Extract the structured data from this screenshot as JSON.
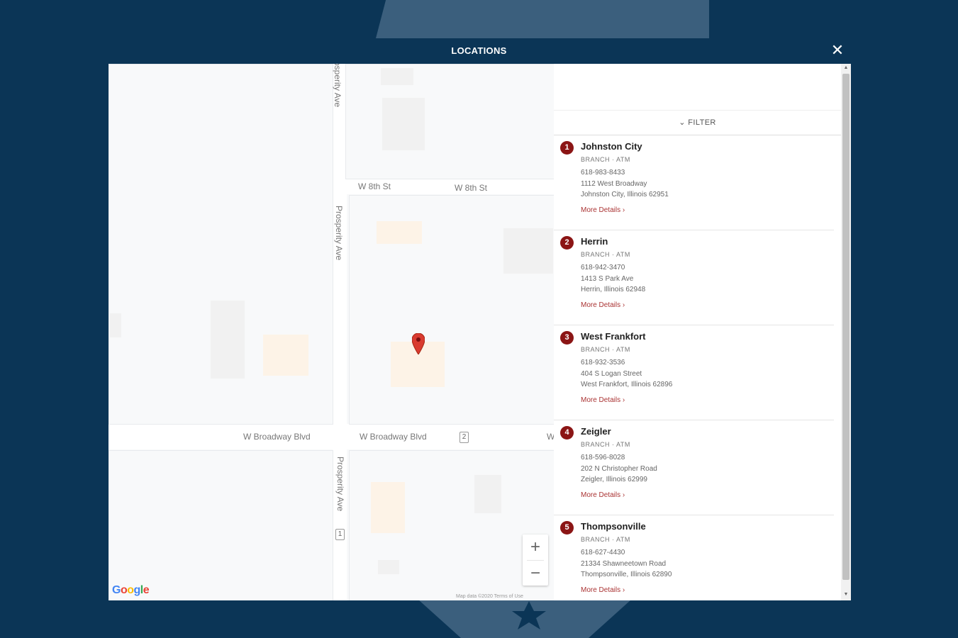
{
  "modal": {
    "title": "LOCATIONS",
    "close_icon": "close-icon"
  },
  "map": {
    "streets": {
      "w8th_a": "W 8th St",
      "w8th_b": "W 8th St",
      "prosperity_top": "Prosperity Ave",
      "prosperity_mid": "Prosperity Ave",
      "prosperity_bot": "Prosperity Ave",
      "broadway_a": "W Broadway Blvd",
      "broadway_b": "W Broadway Blvd",
      "broadway_c": "W"
    },
    "route_shields": [
      "2",
      "1"
    ],
    "zoom_in": "+",
    "zoom_out": "−",
    "google_logo": "Google",
    "attribution": "Map data ©2020   Terms of Use",
    "pin_color": "#d93b30"
  },
  "list": {
    "filter_label": "FILTER",
    "more_details_label": "More Details",
    "locations": [
      {
        "num": "1",
        "name": "Johnston City",
        "type": "BRANCH · ATM",
        "phone": "618-983-8433",
        "addr1": "1112 West Broadway",
        "addr2": "Johnston City, Illinois 62951"
      },
      {
        "num": "2",
        "name": "Herrin",
        "type": "BRANCH · ATM",
        "phone": "618-942-3470",
        "addr1": "1413 S Park Ave",
        "addr2": "Herrin, Illinois 62948"
      },
      {
        "num": "3",
        "name": "West Frankfort",
        "type": "BRANCH · ATM",
        "phone": "618-932-3536",
        "addr1": "404 S Logan Street",
        "addr2": "West Frankfort, Illinois 62896"
      },
      {
        "num": "4",
        "name": "Zeigler",
        "type": "BRANCH · ATM",
        "phone": "618-596-8028",
        "addr1": "202 N Christopher Road",
        "addr2": "Zeigler, Illinois 62999"
      },
      {
        "num": "5",
        "name": "Thompsonville",
        "type": "BRANCH · ATM",
        "phone": "618-627-4430",
        "addr1": "21334 Shawneetown Road",
        "addr2": "Thompsonville, Illinois 62890"
      }
    ]
  },
  "colors": {
    "background": "#0b3556",
    "accent": "#8b1515"
  }
}
